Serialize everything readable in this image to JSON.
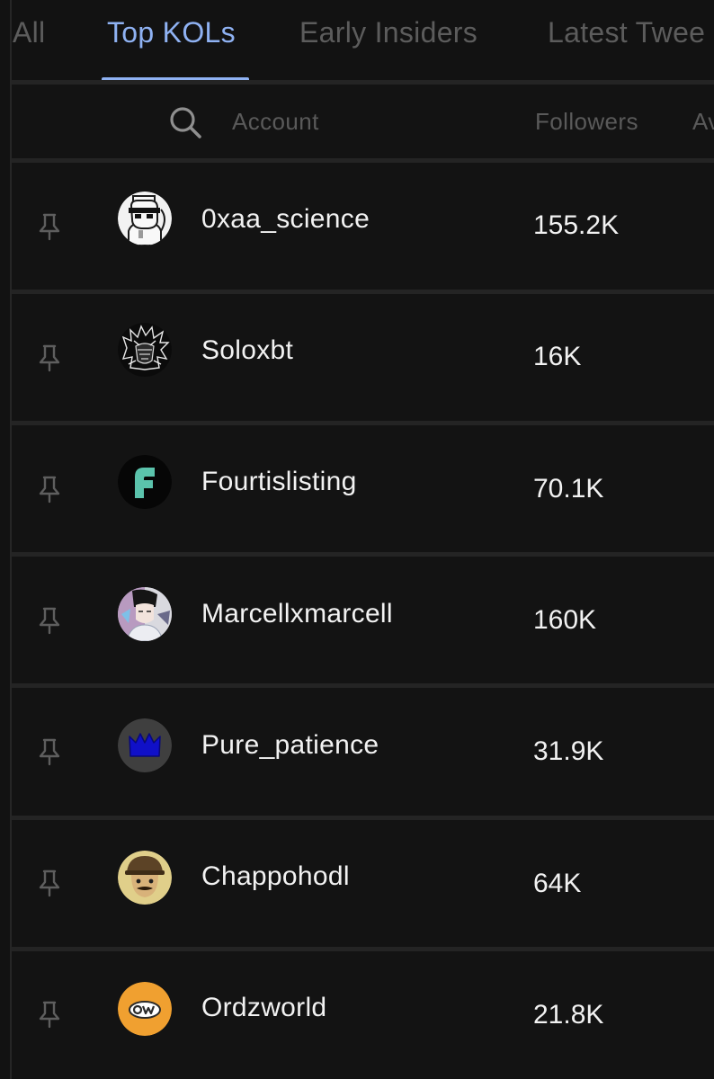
{
  "tabs": [
    {
      "label": "All",
      "active": false
    },
    {
      "label": "Top KOLs",
      "active": true
    },
    {
      "label": "Early Insiders",
      "active": false
    },
    {
      "label": "Latest Twee",
      "active": false
    }
  ],
  "header": {
    "search_icon": "search-icon",
    "account_label": "Account",
    "followers_label": "Followers",
    "next_col_label": "Av"
  },
  "rows": [
    {
      "name": "0xaa_science",
      "followers": "155.2K",
      "pin_icon": "pin-icon"
    },
    {
      "name": "Soloxbt",
      "followers": "16K",
      "pin_icon": "pin-icon"
    },
    {
      "name": "Fourtislisting",
      "followers": "70.1K",
      "pin_icon": "pin-icon"
    },
    {
      "name": "Marcellxmarcell",
      "followers": "160K",
      "pin_icon": "pin-icon"
    },
    {
      "name": "Pure_patience",
      "followers": "31.9K",
      "pin_icon": "pin-icon"
    },
    {
      "name": "Chappohodl",
      "followers": "64K",
      "pin_icon": "pin-icon"
    },
    {
      "name": "Ordzworld",
      "followers": "21.8K",
      "pin_icon": "pin-icon"
    }
  ],
  "colors": {
    "background": "#121212",
    "active_tab": "#8fb2f3",
    "inactive_tab": "#5c5c5c",
    "divider": "#242424",
    "text": "#f2f2f2"
  }
}
